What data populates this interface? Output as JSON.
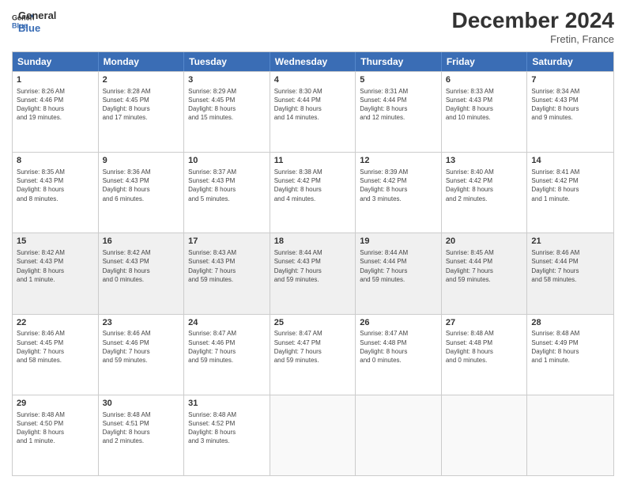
{
  "header": {
    "logo_line1": "General",
    "logo_line2": "Blue",
    "month": "December 2024",
    "location": "Fretin, France"
  },
  "days_of_week": [
    "Sunday",
    "Monday",
    "Tuesday",
    "Wednesday",
    "Thursday",
    "Friday",
    "Saturday"
  ],
  "weeks": [
    [
      {
        "day": "1",
        "info": "Sunrise: 8:26 AM\nSunset: 4:46 PM\nDaylight: 8 hours\nand 19 minutes.",
        "shaded": false
      },
      {
        "day": "2",
        "info": "Sunrise: 8:28 AM\nSunset: 4:45 PM\nDaylight: 8 hours\nand 17 minutes.",
        "shaded": false
      },
      {
        "day": "3",
        "info": "Sunrise: 8:29 AM\nSunset: 4:45 PM\nDaylight: 8 hours\nand 15 minutes.",
        "shaded": false
      },
      {
        "day": "4",
        "info": "Sunrise: 8:30 AM\nSunset: 4:44 PM\nDaylight: 8 hours\nand 14 minutes.",
        "shaded": false
      },
      {
        "day": "5",
        "info": "Sunrise: 8:31 AM\nSunset: 4:44 PM\nDaylight: 8 hours\nand 12 minutes.",
        "shaded": false
      },
      {
        "day": "6",
        "info": "Sunrise: 8:33 AM\nSunset: 4:43 PM\nDaylight: 8 hours\nand 10 minutes.",
        "shaded": false
      },
      {
        "day": "7",
        "info": "Sunrise: 8:34 AM\nSunset: 4:43 PM\nDaylight: 8 hours\nand 9 minutes.",
        "shaded": false
      }
    ],
    [
      {
        "day": "8",
        "info": "Sunrise: 8:35 AM\nSunset: 4:43 PM\nDaylight: 8 hours\nand 8 minutes.",
        "shaded": false
      },
      {
        "day": "9",
        "info": "Sunrise: 8:36 AM\nSunset: 4:43 PM\nDaylight: 8 hours\nand 6 minutes.",
        "shaded": false
      },
      {
        "day": "10",
        "info": "Sunrise: 8:37 AM\nSunset: 4:43 PM\nDaylight: 8 hours\nand 5 minutes.",
        "shaded": false
      },
      {
        "day": "11",
        "info": "Sunrise: 8:38 AM\nSunset: 4:42 PM\nDaylight: 8 hours\nand 4 minutes.",
        "shaded": false
      },
      {
        "day": "12",
        "info": "Sunrise: 8:39 AM\nSunset: 4:42 PM\nDaylight: 8 hours\nand 3 minutes.",
        "shaded": false
      },
      {
        "day": "13",
        "info": "Sunrise: 8:40 AM\nSunset: 4:42 PM\nDaylight: 8 hours\nand 2 minutes.",
        "shaded": false
      },
      {
        "day": "14",
        "info": "Sunrise: 8:41 AM\nSunset: 4:42 PM\nDaylight: 8 hours\nand 1 minute.",
        "shaded": false
      }
    ],
    [
      {
        "day": "15",
        "info": "Sunrise: 8:42 AM\nSunset: 4:43 PM\nDaylight: 8 hours\nand 1 minute.",
        "shaded": true
      },
      {
        "day": "16",
        "info": "Sunrise: 8:42 AM\nSunset: 4:43 PM\nDaylight: 8 hours\nand 0 minutes.",
        "shaded": true
      },
      {
        "day": "17",
        "info": "Sunrise: 8:43 AM\nSunset: 4:43 PM\nDaylight: 7 hours\nand 59 minutes.",
        "shaded": true
      },
      {
        "day": "18",
        "info": "Sunrise: 8:44 AM\nSunset: 4:43 PM\nDaylight: 7 hours\nand 59 minutes.",
        "shaded": true
      },
      {
        "day": "19",
        "info": "Sunrise: 8:44 AM\nSunset: 4:44 PM\nDaylight: 7 hours\nand 59 minutes.",
        "shaded": true
      },
      {
        "day": "20",
        "info": "Sunrise: 8:45 AM\nSunset: 4:44 PM\nDaylight: 7 hours\nand 59 minutes.",
        "shaded": true
      },
      {
        "day": "21",
        "info": "Sunrise: 8:46 AM\nSunset: 4:44 PM\nDaylight: 7 hours\nand 58 minutes.",
        "shaded": true
      }
    ],
    [
      {
        "day": "22",
        "info": "Sunrise: 8:46 AM\nSunset: 4:45 PM\nDaylight: 7 hours\nand 58 minutes.",
        "shaded": false
      },
      {
        "day": "23",
        "info": "Sunrise: 8:46 AM\nSunset: 4:46 PM\nDaylight: 7 hours\nand 59 minutes.",
        "shaded": false
      },
      {
        "day": "24",
        "info": "Sunrise: 8:47 AM\nSunset: 4:46 PM\nDaylight: 7 hours\nand 59 minutes.",
        "shaded": false
      },
      {
        "day": "25",
        "info": "Sunrise: 8:47 AM\nSunset: 4:47 PM\nDaylight: 7 hours\nand 59 minutes.",
        "shaded": false
      },
      {
        "day": "26",
        "info": "Sunrise: 8:47 AM\nSunset: 4:48 PM\nDaylight: 8 hours\nand 0 minutes.",
        "shaded": false
      },
      {
        "day": "27",
        "info": "Sunrise: 8:48 AM\nSunset: 4:48 PM\nDaylight: 8 hours\nand 0 minutes.",
        "shaded": false
      },
      {
        "day": "28",
        "info": "Sunrise: 8:48 AM\nSunset: 4:49 PM\nDaylight: 8 hours\nand 1 minute.",
        "shaded": false
      }
    ],
    [
      {
        "day": "29",
        "info": "Sunrise: 8:48 AM\nSunset: 4:50 PM\nDaylight: 8 hours\nand 1 minute.",
        "shaded": false
      },
      {
        "day": "30",
        "info": "Sunrise: 8:48 AM\nSunset: 4:51 PM\nDaylight: 8 hours\nand 2 minutes.",
        "shaded": false
      },
      {
        "day": "31",
        "info": "Sunrise: 8:48 AM\nSunset: 4:52 PM\nDaylight: 8 hours\nand 3 minutes.",
        "shaded": false
      },
      {
        "day": "",
        "info": "",
        "shaded": false,
        "empty": true
      },
      {
        "day": "",
        "info": "",
        "shaded": false,
        "empty": true
      },
      {
        "day": "",
        "info": "",
        "shaded": false,
        "empty": true
      },
      {
        "day": "",
        "info": "",
        "shaded": false,
        "empty": true
      }
    ]
  ]
}
